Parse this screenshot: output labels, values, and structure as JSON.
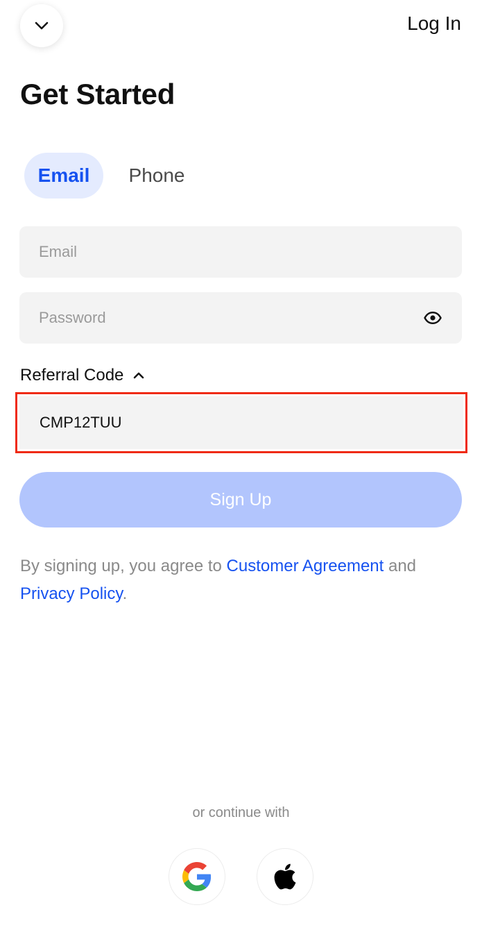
{
  "header": {
    "back_icon": "chevron-down-icon",
    "login_label": "Log In"
  },
  "page": {
    "title": "Get Started"
  },
  "tabs": {
    "items": [
      {
        "label": "Email",
        "selected": true
      },
      {
        "label": "Phone",
        "selected": false
      }
    ]
  },
  "form": {
    "email": {
      "placeholder": "Email",
      "value": ""
    },
    "password": {
      "placeholder": "Password",
      "value": "",
      "toggle_icon": "eye-icon"
    },
    "referral": {
      "label": "Referral Code",
      "toggle_icon": "chevron-up-icon",
      "value": "CMP12TUU"
    },
    "submit_label": "Sign Up"
  },
  "terms": {
    "prefix": "By signing up, you agree to ",
    "agreement_link": "Customer Agreement",
    "middle": " and ",
    "privacy_link": "Privacy Policy",
    "suffix": "."
  },
  "social": {
    "divider_text": "or continue with",
    "providers": [
      {
        "name": "google",
        "icon": "google-icon"
      },
      {
        "name": "apple",
        "icon": "apple-icon"
      }
    ]
  },
  "colors": {
    "accent": "#1652f0",
    "tab_active_bg": "#e4ebfe",
    "button_disabled": "#b2c5fd",
    "field_bg": "#f3f3f3",
    "highlight_border": "#ef2a12"
  }
}
